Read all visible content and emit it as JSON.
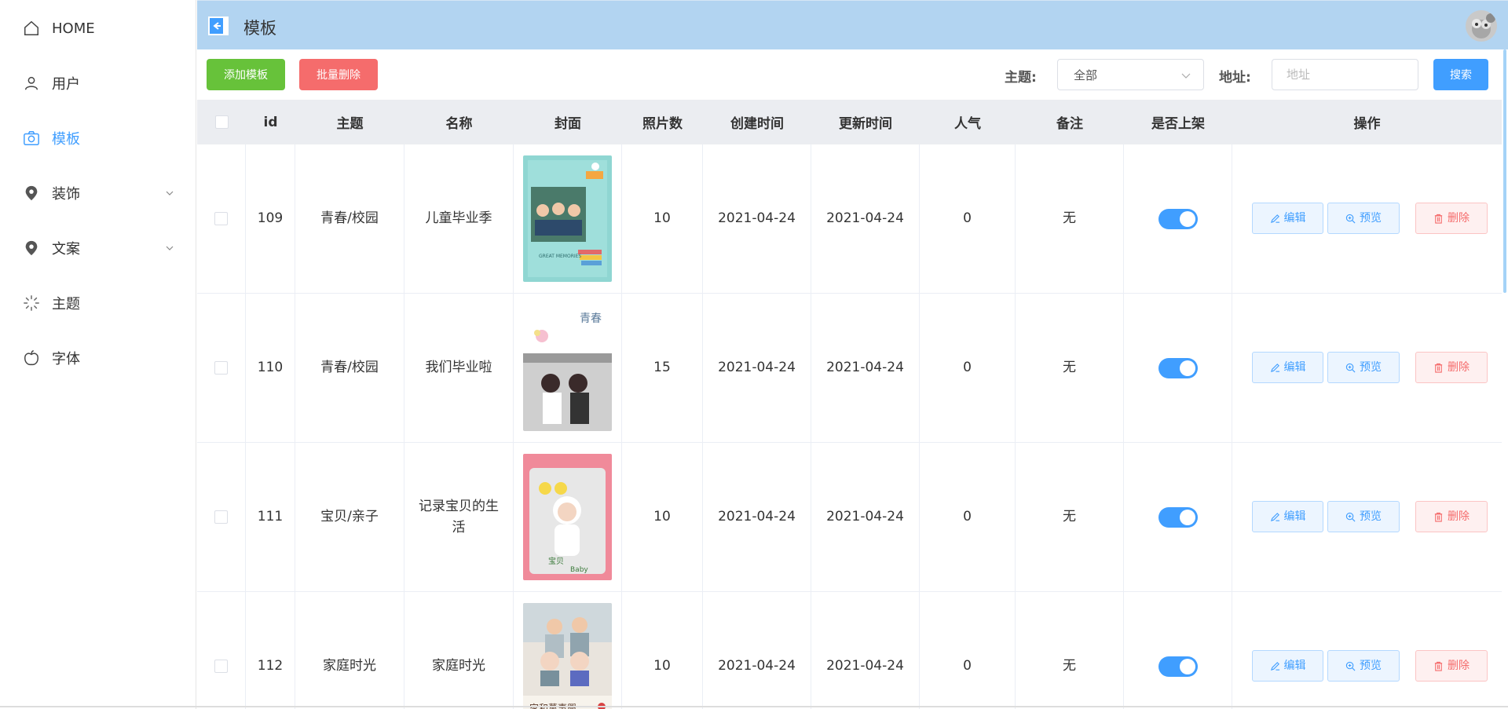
{
  "sidebar": {
    "items": [
      {
        "label": "HOME",
        "icon": "home-icon"
      },
      {
        "label": "用户",
        "icon": "user-icon"
      },
      {
        "label": "模板",
        "icon": "camera-icon",
        "active": true
      },
      {
        "label": "装饰",
        "icon": "location-pin-icon",
        "has_submenu": true
      },
      {
        "label": "文案",
        "icon": "location-pin-icon",
        "has_submenu": true
      },
      {
        "label": "主题",
        "icon": "loading-icon"
      },
      {
        "label": "字体",
        "icon": "apple-icon"
      }
    ]
  },
  "header": {
    "title": "模板"
  },
  "toolbar": {
    "add_label": "添加模板",
    "batch_delete_label": "批量删除",
    "theme_label": "主题:",
    "theme_selected": "全部",
    "address_label": "地址:",
    "address_placeholder": "地址",
    "search_label": "搜索"
  },
  "table": {
    "headers": {
      "id": "id",
      "theme": "主题",
      "name": "名称",
      "cover": "封面",
      "photos": "照片数",
      "created": "创建时间",
      "updated": "更新时间",
      "popularity": "人气",
      "remark": "备注",
      "listed": "是否上架",
      "actions": "操作"
    },
    "rows": [
      {
        "id": "109",
        "theme": "青春/校园",
        "name": "儿童毕业季",
        "photos": "10",
        "created": "2021-04-24",
        "updated": "2021-04-24",
        "popularity": "0",
        "remark": "无",
        "listed": true
      },
      {
        "id": "110",
        "theme": "青春/校园",
        "name": "我们毕业啦",
        "photos": "15",
        "created": "2021-04-24",
        "updated": "2021-04-24",
        "popularity": "0",
        "remark": "无",
        "listed": true
      },
      {
        "id": "111",
        "theme": "宝贝/亲子",
        "name": "记录宝贝的生活",
        "photos": "10",
        "created": "2021-04-24",
        "updated": "2021-04-24",
        "popularity": "0",
        "remark": "无",
        "listed": true
      },
      {
        "id": "112",
        "theme": "家庭时光",
        "name": "家庭时光",
        "photos": "10",
        "created": "2021-04-24",
        "updated": "2021-04-24",
        "popularity": "0",
        "remark": "无",
        "listed": true
      }
    ],
    "action_labels": {
      "edit": "编辑",
      "preview": "预览",
      "delete": "删除"
    }
  },
  "colors": {
    "primary": "#409eff",
    "success": "#67c23a",
    "danger": "#f56c6c",
    "header_bg": "#b2d4f1"
  }
}
